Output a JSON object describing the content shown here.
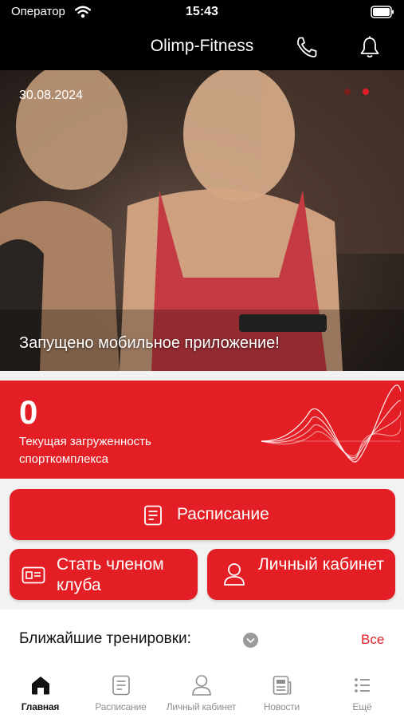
{
  "status_bar": {
    "carrier": "Оператор",
    "time": "15:43"
  },
  "nav": {
    "title": "Olimp-Fitness"
  },
  "banner": {
    "date": "30.08.2024",
    "caption": "Запущено мобильное приложение!",
    "page_count": 2,
    "active_page": 2
  },
  "load": {
    "value": "0",
    "label": "Текущая загруженность спорткомплекса"
  },
  "actions": {
    "schedule_label": "Расписание",
    "membership_label": "Стать членом клуба",
    "account_label": "Личный кабинет"
  },
  "upcoming": {
    "title": "Ближайшие тренировки:",
    "see_all_label": "Все"
  },
  "tabs": [
    {
      "label": "Главная",
      "icon": "home-icon",
      "active": true
    },
    {
      "label": "Расписание",
      "icon": "schedule-icon",
      "active": false
    },
    {
      "label": "Личный кабинет",
      "icon": "user-icon",
      "active": false
    },
    {
      "label": "Новости",
      "icon": "news-icon",
      "active": false
    },
    {
      "label": "Ещё",
      "icon": "more-icon",
      "active": false
    }
  ],
  "colors": {
    "accent": "#e31e24",
    "header": "#000000",
    "background": "#f2f2f2"
  }
}
